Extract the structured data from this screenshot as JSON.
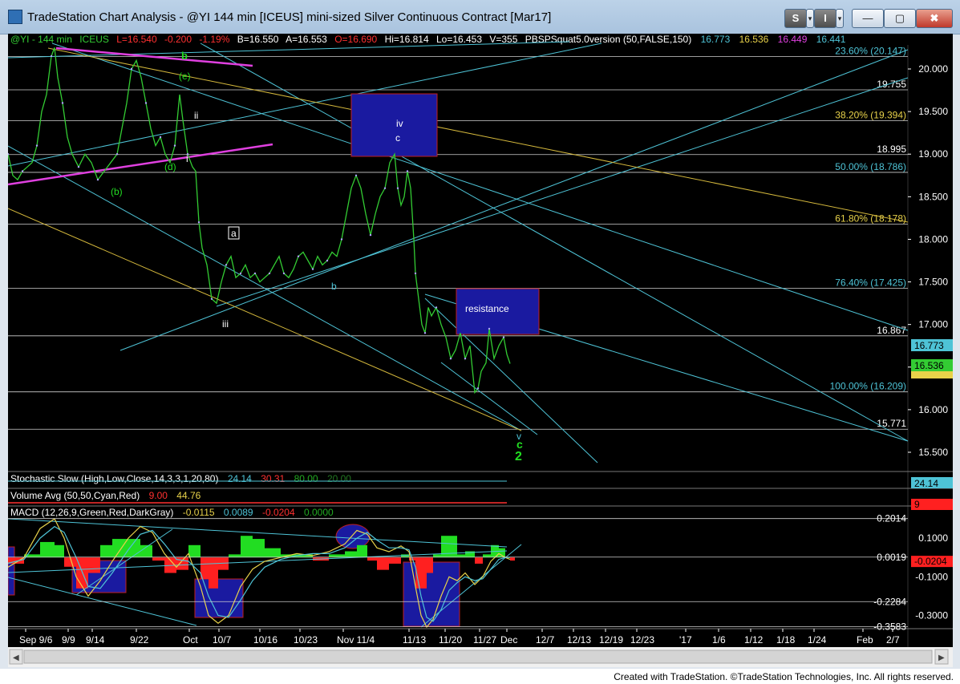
{
  "window": {
    "title": "TradeStation Chart Analysis - @YI 144 min [ICEUS] mini-sized Silver Continuous Contract [Mar17]",
    "btn_s": "S",
    "btn_i": "I",
    "btn_min": "—",
    "btn_max": "▢",
    "btn_close": "✖"
  },
  "header": {
    "symbol": "@YI - 144 min",
    "exchange": "ICEUS",
    "last": "L=16.540",
    "change": "-0.200",
    "pct": "-1.19%",
    "bid": "B=16.550",
    "ask": "A=16.553",
    "open": "O=16.690",
    "high": "Hi=16.814",
    "low": "Lo=16.453",
    "volume": "V=355",
    "indicator": "PBSPSquat5.0version (50,FALSE,150)",
    "v1": "16.773",
    "v2": "16.536",
    "v3": "16.449",
    "v4": "16.441"
  },
  "colors": {
    "bg": "#000000",
    "price": "#33cc33",
    "cyan": "#4ec3d6",
    "yellow": "#d4b83c",
    "magenta": "#e040e0",
    "blue_box": "#1a1aa0",
    "white": "#ffffff",
    "red": "#ff2020",
    "green": "#22dd22"
  },
  "chart_data": {
    "type": "line",
    "title": "@YI 144 min [ICEUS] mini-sized Silver Continuous Contract [Mar17]",
    "price_ticks": [
      "20.000",
      "19.500",
      "19.000",
      "18.500",
      "18.000",
      "17.500",
      "17.000",
      "16.500",
      "16.000",
      "15.500"
    ],
    "ylim": [
      15.2,
      20.3
    ],
    "date_ticks": [
      "Sep 9/6",
      "9/9",
      "9/14",
      "9/22",
      "Oct",
      "10/7",
      "10/16",
      "10/23",
      "Nov 11/4",
      "11/13",
      "11/20",
      "11/27",
      "Dec",
      "12/7",
      "12/13",
      "12/19",
      "12/23",
      "'17",
      "1/6",
      "1/12",
      "1/18",
      "1/24",
      "Feb",
      "2/7"
    ],
    "fib_levels": [
      {
        "label": "23.60% (20.147)",
        "value": 20.147
      },
      {
        "label": "19.755",
        "value": 19.755
      },
      {
        "label": "38.20% (19.394)",
        "value": 19.394
      },
      {
        "label": "18.995",
        "value": 18.995
      },
      {
        "label": "50.00% (18.786)",
        "value": 18.786
      },
      {
        "label": "61.80% (18.178)",
        "value": 18.178
      },
      {
        "label": "76.40% (17.425)",
        "value": 17.425
      },
      {
        "label": "16.867",
        "value": 16.867
      },
      {
        "label": "100.00% (16.209)",
        "value": 16.209
      },
      {
        "label": "15.771",
        "value": 15.771
      }
    ],
    "price_series": [
      [
        0,
        19.0
      ],
      [
        6,
        18.75
      ],
      [
        12,
        18.7
      ],
      [
        18,
        18.8
      ],
      [
        24,
        18.85
      ],
      [
        30,
        18.9
      ],
      [
        36,
        19.1
      ],
      [
        42,
        19.5
      ],
      [
        48,
        19.7
      ],
      [
        54,
        20.15
      ],
      [
        58,
        20.25
      ],
      [
        62,
        19.9
      ],
      [
        68,
        19.6
      ],
      [
        74,
        19.2
      ],
      [
        80,
        19.0
      ],
      [
        88,
        18.85
      ],
      [
        96,
        19.0
      ],
      [
        104,
        18.9
      ],
      [
        112,
        18.7
      ],
      [
        120,
        18.8
      ],
      [
        128,
        18.9
      ],
      [
        136,
        19.0
      ],
      [
        142,
        19.3
      ],
      [
        148,
        19.6
      ],
      [
        154,
        20.0
      ],
      [
        160,
        20.1
      ],
      [
        166,
        19.9
      ],
      [
        172,
        19.6
      ],
      [
        178,
        19.3
      ],
      [
        184,
        19.1
      ],
      [
        190,
        19.2
      ],
      [
        196,
        19.0
      ],
      [
        202,
        18.9
      ],
      [
        208,
        19.1
      ],
      [
        214,
        19.7
      ],
      [
        218,
        19.4
      ],
      [
        224,
        19.0
      ],
      [
        230,
        18.85
      ],
      [
        234,
        18.8
      ],
      [
        238,
        18.2
      ],
      [
        242,
        17.9
      ],
      [
        248,
        17.7
      ],
      [
        254,
        17.3
      ],
      [
        260,
        17.25
      ],
      [
        266,
        17.5
      ],
      [
        272,
        17.7
      ],
      [
        278,
        17.8
      ],
      [
        284,
        17.55
      ],
      [
        290,
        17.6
      ],
      [
        296,
        17.7
      ],
      [
        302,
        17.55
      ],
      [
        308,
        17.6
      ],
      [
        314,
        17.5
      ],
      [
        320,
        17.55
      ],
      [
        326,
        17.6
      ],
      [
        332,
        17.7
      ],
      [
        338,
        17.8
      ],
      [
        344,
        17.6
      ],
      [
        350,
        17.55
      ],
      [
        356,
        17.65
      ],
      [
        362,
        17.8
      ],
      [
        368,
        17.85
      ],
      [
        374,
        17.75
      ],
      [
        380,
        17.65
      ],
      [
        386,
        17.8
      ],
      [
        392,
        17.7
      ],
      [
        398,
        17.75
      ],
      [
        404,
        17.85
      ],
      [
        410,
        17.8
      ],
      [
        416,
        18.0
      ],
      [
        422,
        18.3
      ],
      [
        428,
        18.6
      ],
      [
        434,
        18.75
      ],
      [
        440,
        18.6
      ],
      [
        446,
        18.3
      ],
      [
        452,
        18.05
      ],
      [
        458,
        18.3
      ],
      [
        464,
        18.5
      ],
      [
        470,
        18.6
      ],
      [
        476,
        18.9
      ],
      [
        482,
        19.0
      ],
      [
        486,
        18.6
      ],
      [
        490,
        18.4
      ],
      [
        494,
        18.5
      ],
      [
        498,
        18.8
      ],
      [
        502,
        18.6
      ],
      [
        506,
        18.0
      ],
      [
        508,
        17.6
      ],
      [
        512,
        17.3
      ],
      [
        516,
        17.0
      ],
      [
        520,
        16.9
      ],
      [
        524,
        17.2
      ],
      [
        528,
        17.1
      ],
      [
        534,
        17.2
      ],
      [
        540,
        17.0
      ],
      [
        546,
        16.85
      ],
      [
        552,
        16.6
      ],
      [
        558,
        16.7
      ],
      [
        564,
        16.9
      ],
      [
        570,
        16.6
      ],
      [
        576,
        16.75
      ],
      [
        582,
        16.2
      ],
      [
        586,
        16.25
      ],
      [
        590,
        16.45
      ],
      [
        596,
        16.55
      ],
      [
        600,
        16.95
      ],
      [
        606,
        16.6
      ],
      [
        612,
        16.75
      ],
      [
        618,
        16.85
      ],
      [
        622,
        16.65
      ],
      [
        626,
        16.54
      ]
    ],
    "annotations": [
      "b",
      "(e)",
      "ii",
      "(d)",
      "i",
      "(b)",
      "a",
      "iii",
      "b",
      "iv",
      "c",
      "resistance",
      "v",
      "c",
      "2"
    ],
    "stochastic": {
      "label": "Stochastic Slow (High,Low,Close,14,3,3,1,20,80)",
      "v1": "24.14",
      "v2": "30.31",
      "v3": "80.00",
      "v4": "20.00",
      "right": "24.14"
    },
    "volume": {
      "label": "Volume Avg (50,50,Cyan,Red)",
      "v1": "9.00",
      "v2": "44.76",
      "right": "9"
    },
    "macd": {
      "label": "MACD (12,26,9,Green,Red,DarkGray)",
      "v1": "-0.0115",
      "v2": "0.0089",
      "v3": "-0.0204",
      "v4": "0.0000",
      "ticks": [
        "0.2014",
        "0.1000",
        "0.0019",
        "-0.0204",
        "-0.1000",
        "-0.2284",
        "-0.3000",
        "-0.3583"
      ],
      "ylim": [
        -0.4,
        0.25
      ],
      "macd_line": [
        [
          0,
          -0.05
        ],
        [
          20,
          0.0
        ],
        [
          40,
          0.15
        ],
        [
          58,
          0.2
        ],
        [
          70,
          0.1
        ],
        [
          85,
          -0.1
        ],
        [
          100,
          -0.2
        ],
        [
          115,
          -0.12
        ],
        [
          130,
          -0.02
        ],
        [
          150,
          0.1
        ],
        [
          165,
          0.16
        ],
        [
          180,
          0.13
        ],
        [
          195,
          0.02
        ],
        [
          210,
          -0.05
        ],
        [
          225,
          0.02
        ],
        [
          240,
          -0.15
        ],
        [
          250,
          -0.3
        ],
        [
          262,
          -0.34
        ],
        [
          275,
          -0.3
        ],
        [
          290,
          -0.15
        ],
        [
          305,
          -0.06
        ],
        [
          320,
          -0.02
        ],
        [
          340,
          0.0
        ],
        [
          360,
          0.02
        ],
        [
          380,
          0.01
        ],
        [
          400,
          0.03
        ],
        [
          420,
          0.07
        ],
        [
          435,
          0.14
        ],
        [
          448,
          0.12
        ],
        [
          460,
          0.05
        ],
        [
          475,
          0.03
        ],
        [
          490,
          0.06
        ],
        [
          500,
          0.03
        ],
        [
          508,
          -0.15
        ],
        [
          515,
          -0.3
        ],
        [
          522,
          -0.36
        ],
        [
          530,
          -0.32
        ],
        [
          540,
          -0.2
        ],
        [
          550,
          -0.1
        ],
        [
          560,
          -0.12
        ],
        [
          570,
          -0.08
        ],
        [
          582,
          -0.14
        ],
        [
          592,
          -0.1
        ],
        [
          602,
          -0.02
        ],
        [
          612,
          0.02
        ],
        [
          620,
          0.0
        ],
        [
          626,
          -0.01
        ]
      ],
      "signal_line": [
        [
          0,
          -0.03
        ],
        [
          20,
          -0.01
        ],
        [
          40,
          0.1
        ],
        [
          58,
          0.16
        ],
        [
          70,
          0.13
        ],
        [
          85,
          0.0
        ],
        [
          100,
          -0.15
        ],
        [
          115,
          -0.16
        ],
        [
          130,
          -0.08
        ],
        [
          150,
          0.04
        ],
        [
          165,
          0.12
        ],
        [
          180,
          0.14
        ],
        [
          195,
          0.07
        ],
        [
          210,
          -0.01
        ],
        [
          225,
          -0.02
        ],
        [
          240,
          -0.08
        ],
        [
          250,
          -0.2
        ],
        [
          262,
          -0.3
        ],
        [
          275,
          -0.31
        ],
        [
          290,
          -0.22
        ],
        [
          305,
          -0.12
        ],
        [
          320,
          -0.05
        ],
        [
          340,
          -0.01
        ],
        [
          360,
          0.01
        ],
        [
          380,
          0.02
        ],
        [
          400,
          0.02
        ],
        [
          420,
          0.05
        ],
        [
          435,
          0.1
        ],
        [
          448,
          0.13
        ],
        [
          460,
          0.09
        ],
        [
          475,
          0.05
        ],
        [
          490,
          0.05
        ],
        [
          500,
          0.04
        ],
        [
          508,
          -0.05
        ],
        [
          515,
          -0.2
        ],
        [
          522,
          -0.31
        ],
        [
          530,
          -0.33
        ],
        [
          540,
          -0.27
        ],
        [
          550,
          -0.17
        ],
        [
          560,
          -0.13
        ],
        [
          570,
          -0.1
        ],
        [
          582,
          -0.12
        ],
        [
          592,
          -0.11
        ],
        [
          602,
          -0.06
        ],
        [
          612,
          -0.01
        ],
        [
          620,
          0.0
        ],
        [
          626,
          0.0
        ]
      ]
    }
  },
  "footer": {
    "credit": "Created with TradeStation. ©TradeStation Technologies, Inc. All rights reserved."
  }
}
